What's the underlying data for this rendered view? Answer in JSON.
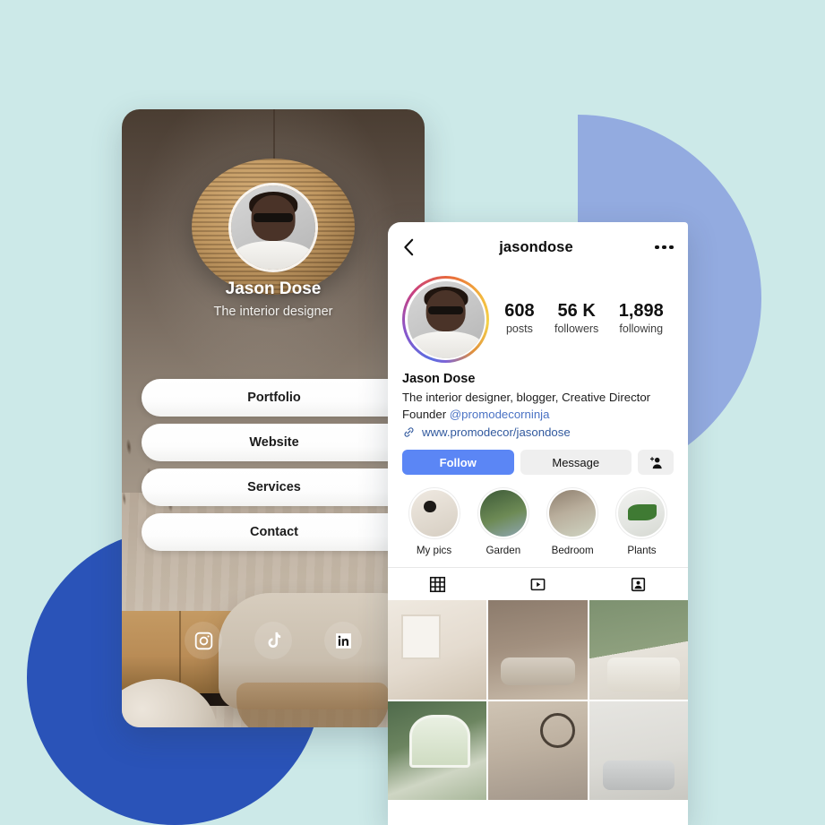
{
  "theme": {
    "background_color": "#cce9e8",
    "shape_light_blue": "#93abe0",
    "shape_deep_blue": "#2a53b8",
    "follow_button_color": "#5b86f5",
    "link_text_color": "#31599e"
  },
  "link_card": {
    "name": "Jason Dose",
    "tagline": "The interior designer",
    "buttons": [
      {
        "label": "Portfolio"
      },
      {
        "label": "Website"
      },
      {
        "label": "Services"
      },
      {
        "label": "Contact"
      }
    ],
    "socials": [
      {
        "icon": "instagram-icon",
        "name": "Instagram"
      },
      {
        "icon": "tiktok-icon",
        "name": "TikTok"
      },
      {
        "icon": "linkedin-icon",
        "name": "LinkedIn"
      }
    ]
  },
  "profile_card": {
    "topbar": {
      "back_icon": "chevron-left-icon",
      "handle": "jasondose",
      "more_icon": "more-options-icon"
    },
    "avatar_alt": "Jason Dose profile photo",
    "stats": [
      {
        "value": "608",
        "label": "posts"
      },
      {
        "value": "56 K",
        "label": "followers"
      },
      {
        "value": "1,898",
        "label": "following"
      }
    ],
    "bio": {
      "full_name": "Jason Dose",
      "line1": "The interior designer, blogger, Creative Director",
      "line2_prefix": "Founder ",
      "mention": "@promodecorninja",
      "website_icon": "link-icon",
      "website": "www.promodecor/jasondose"
    },
    "actions": {
      "follow_label": "Follow",
      "message_label": "Message",
      "add_user_icon": "add-person-icon"
    },
    "highlights": [
      {
        "label": "My pics"
      },
      {
        "label": "Garden"
      },
      {
        "label": "Bedroom"
      },
      {
        "label": "Plants"
      }
    ],
    "tabs": [
      {
        "icon": "grid-icon",
        "name": "Posts grid",
        "active": true
      },
      {
        "icon": "reels-icon",
        "name": "Reels",
        "active": false
      },
      {
        "icon": "tagged-icon",
        "name": "Tagged",
        "active": false
      }
    ],
    "grid_posts": [
      {
        "alt": "Beige living room with armchair and framed art"
      },
      {
        "alt": "Neutral sofa with wooden coffee table"
      },
      {
        "alt": "Bedroom with green accent wall and shelf"
      },
      {
        "alt": "Green room with arched garden window"
      },
      {
        "alt": "Beige room with round mirror and branch vase"
      },
      {
        "alt": "Grey sofa with yellow cushion and wall art"
      }
    ]
  }
}
